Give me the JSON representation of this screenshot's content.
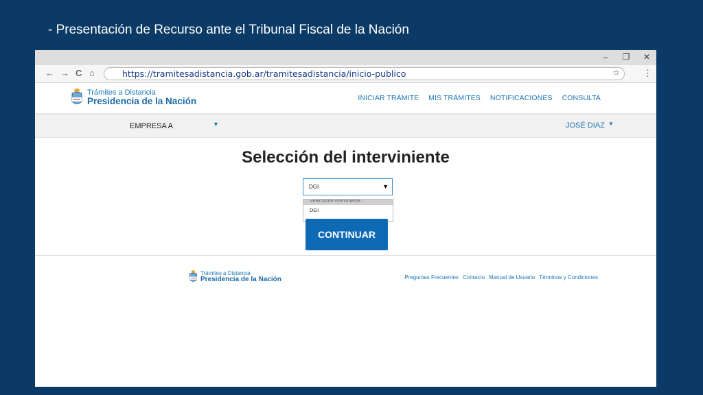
{
  "slide": {
    "title": "- Presentación de Recurso ante el Tribunal Fiscal de la Nación"
  },
  "browser": {
    "url": "https://tramitesadistancia.gob.ar/tramitesadistancia/inicio-publico",
    "controls": {
      "minimize": "–",
      "restore": "❐",
      "close": "✕"
    },
    "nav": {
      "back": "←",
      "forward": "→",
      "reload": "C",
      "home": "⌂"
    },
    "star": "☆",
    "menu": "⋮"
  },
  "site": {
    "logo_line1": "Trámites a Distancia",
    "logo_line2": "Presidencia de la Nación",
    "nav": [
      "INICIAR TRÁMITE",
      "MIS TRÁMITES",
      "NOTIFICACIONES",
      "CONSULTA"
    ]
  },
  "subbar": {
    "company": "EMPRESA  A",
    "company_caret": "▼",
    "user": "JOSÉ DIAZ",
    "user_caret": "▼"
  },
  "main": {
    "heading": "Selección del interviniente",
    "select_value": "DGI",
    "select_arrow": "▼",
    "options": [
      "Seleccione interviniente...",
      "DGI"
    ],
    "continue_label": "CONTINUAR"
  },
  "footer": {
    "logo_line1": "Trámites a Distancia",
    "logo_line2": "Presidencia de la Nación",
    "links": [
      "Preguntas Frecuentes",
      "Contacto",
      "Manual de Usuario",
      "Términos y Condiciones"
    ]
  },
  "colors": {
    "slide_bg": "#0b3a66",
    "accent": "#0f6ab5",
    "link": "#1d74b5"
  }
}
